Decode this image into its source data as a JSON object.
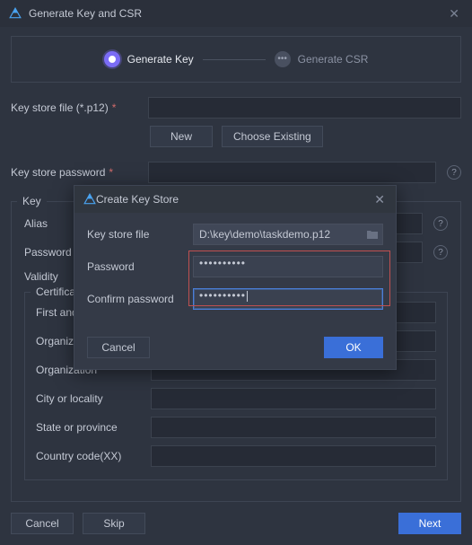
{
  "window": {
    "title": "Generate Key and CSR"
  },
  "steps": {
    "step1": "Generate Key",
    "step2": "Generate CSR"
  },
  "labels": {
    "key_store_file": "Key store file (*.p12)",
    "key_store_password": "Key store password",
    "btn_new": "New",
    "btn_choose_existing": "Choose Existing",
    "key_legend": "Key",
    "alias": "Alias",
    "password": "Password",
    "validity": "Validity",
    "cert_legend": "Certificate",
    "first": "First and last name",
    "organizational_unit": "Organizational unit",
    "organization": "Organization",
    "city": "City or locality",
    "state": "State or province",
    "country": "Country code(XX)",
    "cancel": "Cancel",
    "skip": "Skip",
    "next": "Next"
  },
  "values": {
    "key_store_file": "",
    "key_store_password": "",
    "alias": "",
    "password": "",
    "validity": "",
    "first": "",
    "org_unit": "",
    "organization": "",
    "city": "",
    "state": "",
    "country": ""
  },
  "modal": {
    "title": "Create Key Store",
    "key_store_file_label": "Key store file",
    "key_store_file_value": "D:\\key\\demo\\taskdemo.p12",
    "password_label": "Password",
    "password_value": "••••••••••",
    "confirm_label": "Confirm password",
    "confirm_value": "••••••••••",
    "cancel": "Cancel",
    "ok": "OK"
  }
}
